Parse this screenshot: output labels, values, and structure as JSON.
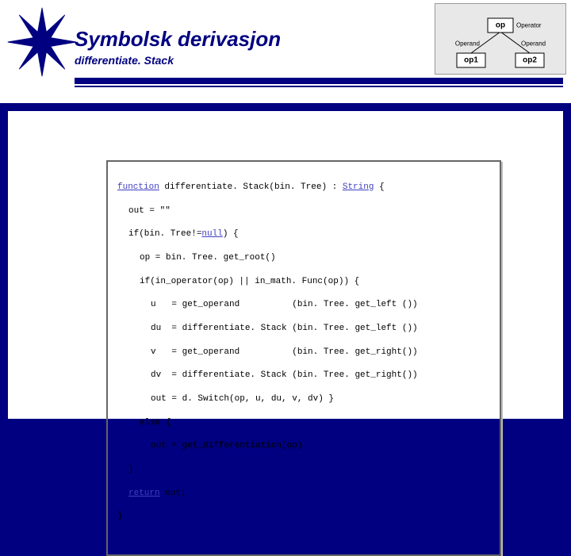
{
  "header": {
    "title": "Symbolsk derivasjon",
    "subtitle": "differentiate. Stack"
  },
  "tree": {
    "root": "op",
    "rootLabel": "Operator",
    "leftEdge": "Operand",
    "rightEdge": "Operand",
    "left": "op1",
    "right": "op2"
  },
  "kw": {
    "function": "function",
    "String": "String",
    "null": "null",
    "return": "return"
  },
  "code": {
    "l01a": " differentiate. Stack(bin. Tree) : ",
    "l01b": " {",
    "l02": "out = \"\"",
    "l03a": "if(bin. Tree!=",
    "l03b": ") {",
    "l04": "op = bin. Tree. get_root()",
    "l05": "if(in_operator(op) || in_math. Func(op)) {",
    "l06": "u   = get_operand          (bin. Tree. get_left ())",
    "l07": "du  = differentiate. Stack (bin. Tree. get_left ())",
    "l08": "v   = get_operand          (bin. Tree. get_right())",
    "l09": "dv  = differentiate. Stack (bin. Tree. get_right())",
    "l10": "out = d. Switch(op, u, du, v, dv) }",
    "l11": "else {",
    "l12": "out = get_differentiation(op)",
    "l13": "}",
    "l14a": " out;",
    "l15": "}"
  }
}
